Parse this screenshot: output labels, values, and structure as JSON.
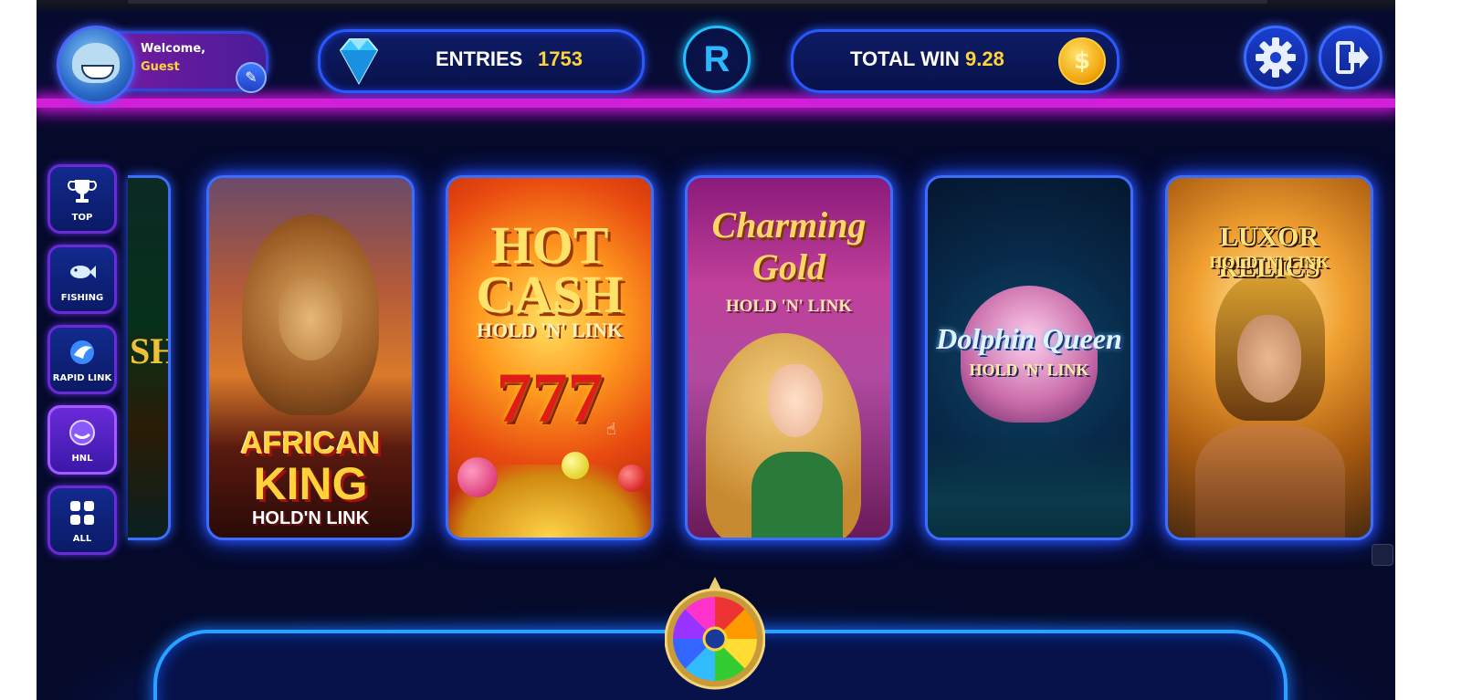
{
  "header": {
    "profile": {
      "welcome": "Welcome,",
      "name": "Guest"
    },
    "entries": {
      "label": "ENTRIES",
      "value": "1753"
    },
    "r_button": "R",
    "total_win": {
      "label": "TOTAL WIN",
      "value": "9.28"
    },
    "coin_symbol": "$"
  },
  "sidebar": {
    "items": [
      {
        "label": "TOP",
        "icon": "trophy-icon"
      },
      {
        "label": "FISHING",
        "icon": "fish-icon"
      },
      {
        "label": "RAPID LINK",
        "icon": "rapid-link-icon"
      },
      {
        "label": "HNL",
        "icon": "hnl-icon",
        "active": true
      },
      {
        "label": "ALL",
        "icon": "grid-icon"
      }
    ]
  },
  "games": {
    "partial_fragment": "SH",
    "african_king": {
      "line1": "AFRICAN",
      "line2": "KING",
      "line3": "HOLD'N LINK"
    },
    "hot_cash": {
      "line1": "HOT",
      "line2": "CASH",
      "line3": "HOLD 'N' LINK",
      "symbol": "777"
    },
    "charming_gold": {
      "line1": "Charming",
      "line2": "Gold",
      "line3": "HOLD 'N' LINK"
    },
    "dolphin_queen": {
      "line1": "Dolphin Queen",
      "line3": "HOLD 'N' LINK"
    },
    "luxor_relics": {
      "line1": "LUXOR RELICS",
      "line3": "HOLD 'N' LINK"
    }
  },
  "colors": {
    "background": "#050a2a",
    "accent_magenta": "#d21fd8",
    "accent_blue": "#2a58ff",
    "value_yellow": "#ffd23a"
  }
}
